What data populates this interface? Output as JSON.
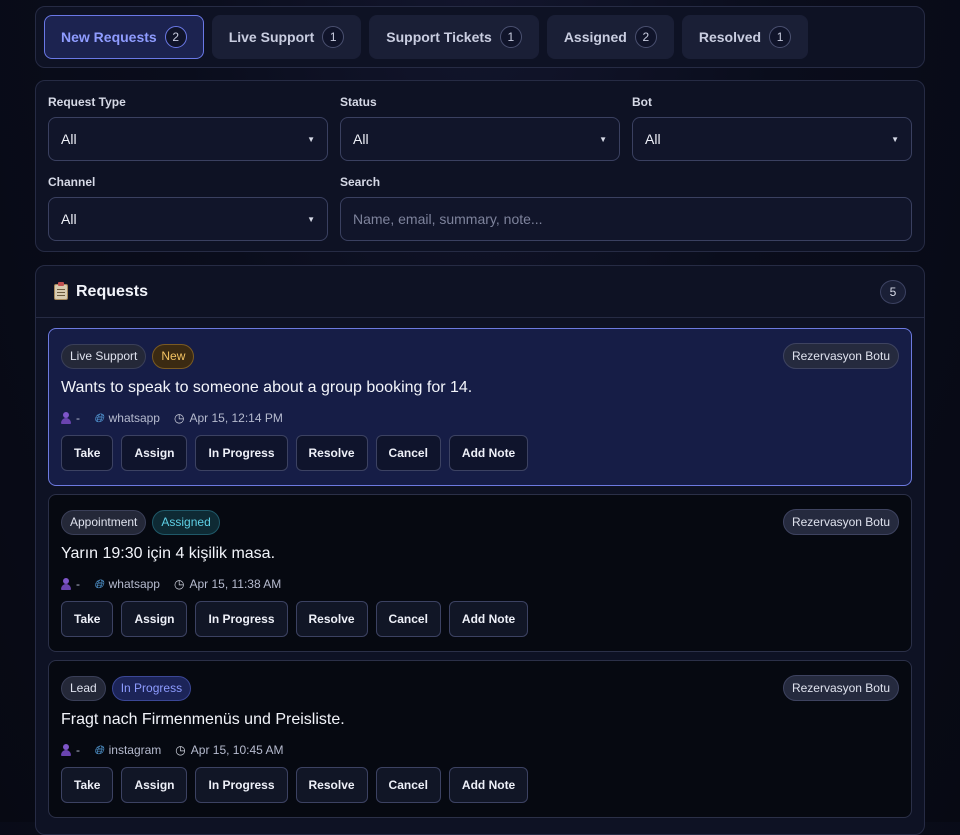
{
  "tabs": [
    {
      "label": "New Requests",
      "count": "2",
      "active": true
    },
    {
      "label": "Live Support",
      "count": "1"
    },
    {
      "label": "Support Tickets",
      "count": "1"
    },
    {
      "label": "Assigned",
      "count": "2"
    },
    {
      "label": "Resolved",
      "count": "1"
    }
  ],
  "filters": {
    "request_type": {
      "label": "Request Type",
      "value": "All"
    },
    "status": {
      "label": "Status",
      "value": "All"
    },
    "bot": {
      "label": "Bot",
      "value": "All"
    },
    "channel": {
      "label": "Channel",
      "value": "All"
    },
    "search": {
      "label": "Search",
      "placeholder": "Name, email, summary, note..."
    }
  },
  "requests": {
    "title": "Requests",
    "total": "5",
    "items": [
      {
        "type": "Live Support",
        "status": "New",
        "bot": "Rezervasyon Botu",
        "summary": "Wants to speak to someone about a group booking for 14.",
        "person": "-",
        "channel": "whatsapp",
        "time": "Apr 15, 12:14 PM"
      },
      {
        "type": "Appointment",
        "status": "Assigned",
        "bot": "Rezervasyon Botu",
        "summary": "Yarın 19:30 için 4 kişilik masa.",
        "person": "-",
        "channel": "whatsapp",
        "time": "Apr 15, 11:38 AM"
      },
      {
        "type": "Lead",
        "status": "In Progress",
        "bot": "Rezervasyon Botu",
        "summary": "Fragt nach Firmenmenüs und Preisliste.",
        "person": "-",
        "channel": "instagram",
        "time": "Apr 15, 10:45 AM"
      }
    ]
  },
  "actions": {
    "take": "Take",
    "assign": "Assign",
    "in_progress": "In Progress",
    "resolve": "Resolve",
    "cancel": "Cancel",
    "add_note": "Add Note"
  },
  "icons": {
    "person": "person-icon",
    "channel": "globe-icon",
    "time": "clock-icon",
    "header": "clipboard-icon",
    "select": "caret-down-icon"
  },
  "colors": {
    "accent": "#6a78e6",
    "new": "#f3c363",
    "assigned": "#5fd0e6",
    "in_progress": "#8e9cff"
  }
}
